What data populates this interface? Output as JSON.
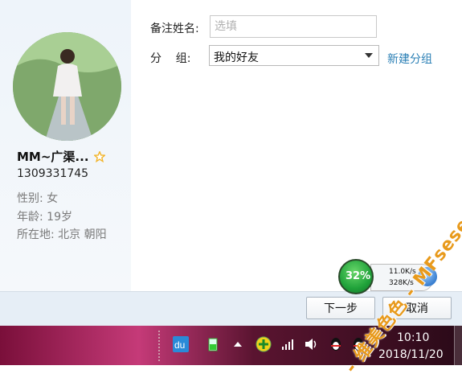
{
  "profile": {
    "nickname": "MM~广渠...",
    "qq_number": "1309331745",
    "gender": "性别: 女",
    "age": "年龄: 19岁",
    "location": "所在地: 北京  朝阳"
  },
  "form": {
    "remark_label": "备注姓名:",
    "remark_placeholder": "选填",
    "group_label": "分    组:",
    "group_value": "我的好友",
    "new_group_link": "新建分组"
  },
  "buttons": {
    "next": "下一步",
    "cancel": "取消"
  },
  "taskbar": {
    "time": "10:10",
    "date": "2018/11/20"
  },
  "net_monitor": {
    "percent": "32%",
    "upload": "11.0K/s",
    "download": "328K/s"
  },
  "watermark": "- 维美色色 - MFsese.com",
  "colors": {
    "link": "#2a7fb5",
    "star": "#f2b42a",
    "taskbar": "#c53a78"
  }
}
